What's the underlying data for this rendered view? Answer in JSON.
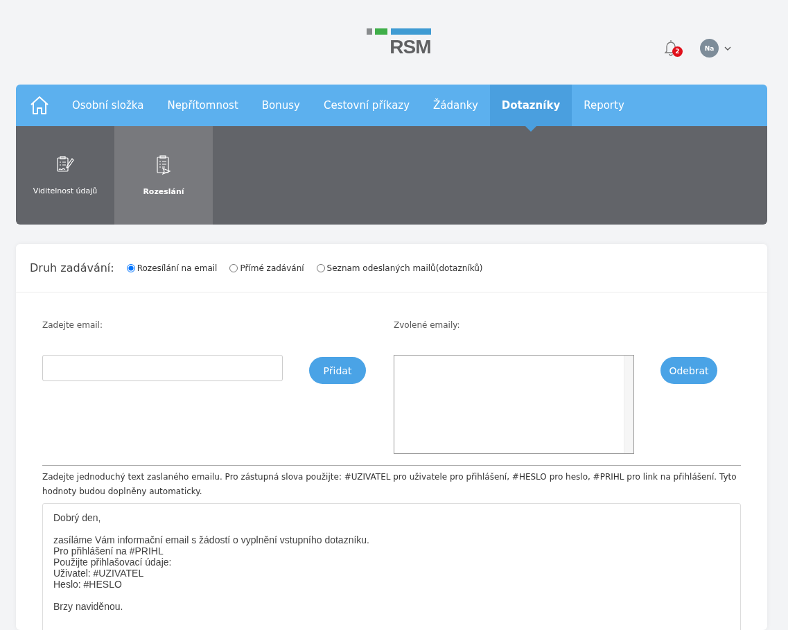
{
  "header": {
    "logo": "RSM",
    "notifications": {
      "count": "2"
    },
    "user": {
      "initials": "Na"
    }
  },
  "nav": {
    "items": [
      {
        "label": "Osobní složka",
        "selected": false
      },
      {
        "label": "Nepřítomnost",
        "selected": false
      },
      {
        "label": "Bonusy",
        "selected": false
      },
      {
        "label": "Cestovní příkazy",
        "selected": false
      },
      {
        "label": "Žádanky",
        "selected": false
      },
      {
        "label": "Dotazníky",
        "selected": true
      },
      {
        "label": "Reporty",
        "selected": false
      }
    ]
  },
  "subnav": {
    "items": [
      {
        "label": "Viditelnost údajů",
        "kind": "sign",
        "selected": false
      },
      {
        "label": "Rozeslání",
        "kind": "send",
        "selected": true
      }
    ]
  },
  "input_type": {
    "label": "Druh zadávání:",
    "options": [
      {
        "label": "Rozesílání na email",
        "selected": true
      },
      {
        "label": "Přímé zadávání",
        "selected": false
      },
      {
        "label": "Seznam odeslaných mailů(dotazníků)",
        "selected": false
      }
    ]
  },
  "form": {
    "email_label": "Zadejte email:",
    "add_button": "Přidat",
    "selected_label": "Zvolené emaily:",
    "remove_button": "Odebrat",
    "hint": "Zadejte jednoduchý text zaslaného emailu. Pro zástupná slova použijte: #UZIVATEL pro uživatele pro přihlášení, #HESLO pro heslo, #PRIHL pro link na přihlášení. Tyto hodnoty budou doplněny automaticky.",
    "message": "Dobrý den,\n\nzasíláme Vám informační email s žádostí o vyplnění vstupního dotazníku.\nPro přihlášení na #PRIHL\nPoužijte přihlašovací údaje:\nUživatel: #UZIVATEL\nHeslo: #HESLO\n\nBrzy naviděnou."
  }
}
